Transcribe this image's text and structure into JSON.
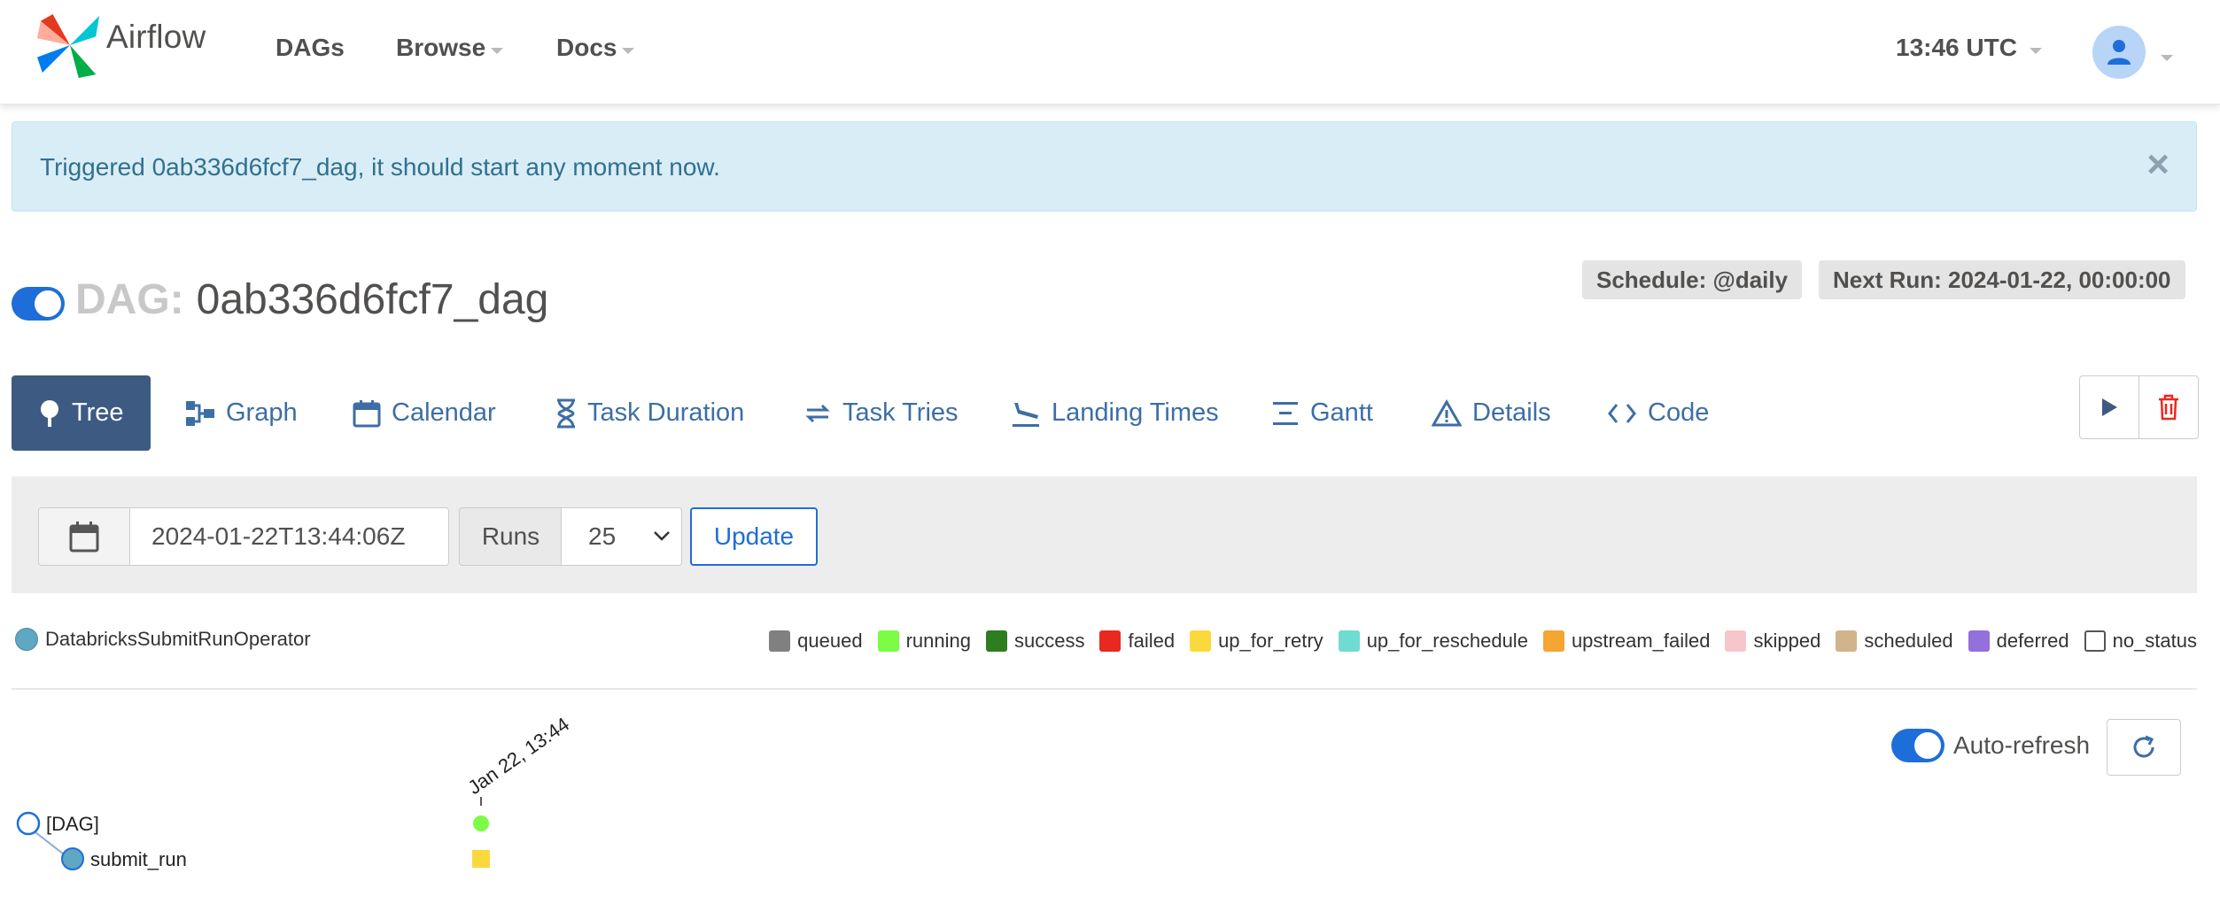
{
  "navbar": {
    "brand": "Airflow",
    "items": [
      {
        "label": "DAGs",
        "has_caret": false
      },
      {
        "label": "Browse",
        "has_caret": true
      },
      {
        "label": "Docs",
        "has_caret": true
      }
    ],
    "time": "13:46 UTC"
  },
  "alert": {
    "message": "Triggered 0ab336d6fcf7_dag, it should start any moment now.",
    "close": "×"
  },
  "dag": {
    "label": "DAG:",
    "id": "0ab336d6fcf7_dag",
    "paused": false,
    "schedule": "Schedule: @daily",
    "next_run": "Next Run: 2024-01-22, 00:00:00"
  },
  "tabs": [
    {
      "label": "Tree",
      "icon": "tree-icon",
      "active": true
    },
    {
      "label": "Graph",
      "icon": "graph-icon",
      "active": false
    },
    {
      "label": "Calendar",
      "icon": "calendar-icon",
      "active": false
    },
    {
      "label": "Task Duration",
      "icon": "hourglass-icon",
      "active": false
    },
    {
      "label": "Task Tries",
      "icon": "repeat-icon",
      "active": false
    },
    {
      "label": "Landing Times",
      "icon": "plane-landing-icon",
      "active": false
    },
    {
      "label": "Gantt",
      "icon": "gantt-icon",
      "active": false
    },
    {
      "label": "Details",
      "icon": "warning-triangle-icon",
      "active": false
    },
    {
      "label": "Code",
      "icon": "code-icon",
      "active": false
    }
  ],
  "controls": {
    "base_date": "2024-01-22T13:44:06Z",
    "runs_label": "Runs",
    "runs_value": "25",
    "update_label": "Update"
  },
  "legend": {
    "operator": "DatabricksSubmitRunOperator",
    "states": [
      {
        "label": "queued",
        "color": "#808080"
      },
      {
        "label": "running",
        "color": "#7cfc44"
      },
      {
        "label": "success",
        "color": "#2e7d1f"
      },
      {
        "label": "failed",
        "color": "#e8291f"
      },
      {
        "label": "up_for_retry",
        "color": "#fad93d"
      },
      {
        "label": "up_for_reschedule",
        "color": "#6fdcd2"
      },
      {
        "label": "upstream_failed",
        "color": "#f5a531"
      },
      {
        "label": "skipped",
        "color": "#f7c6cc"
      },
      {
        "label": "scheduled",
        "color": "#d2b48c"
      },
      {
        "label": "deferred",
        "color": "#9370db"
      },
      {
        "label": "no_status",
        "color": "#ffffff"
      }
    ]
  },
  "tree": {
    "auto_refresh_label": "Auto-refresh",
    "auto_refresh_on": true,
    "run_date_label": "Jan 22, 13:44",
    "nodes": [
      {
        "label": "[DAG]",
        "state": "running"
      },
      {
        "label": "submit_run",
        "state": "up_for_retry"
      }
    ]
  }
}
